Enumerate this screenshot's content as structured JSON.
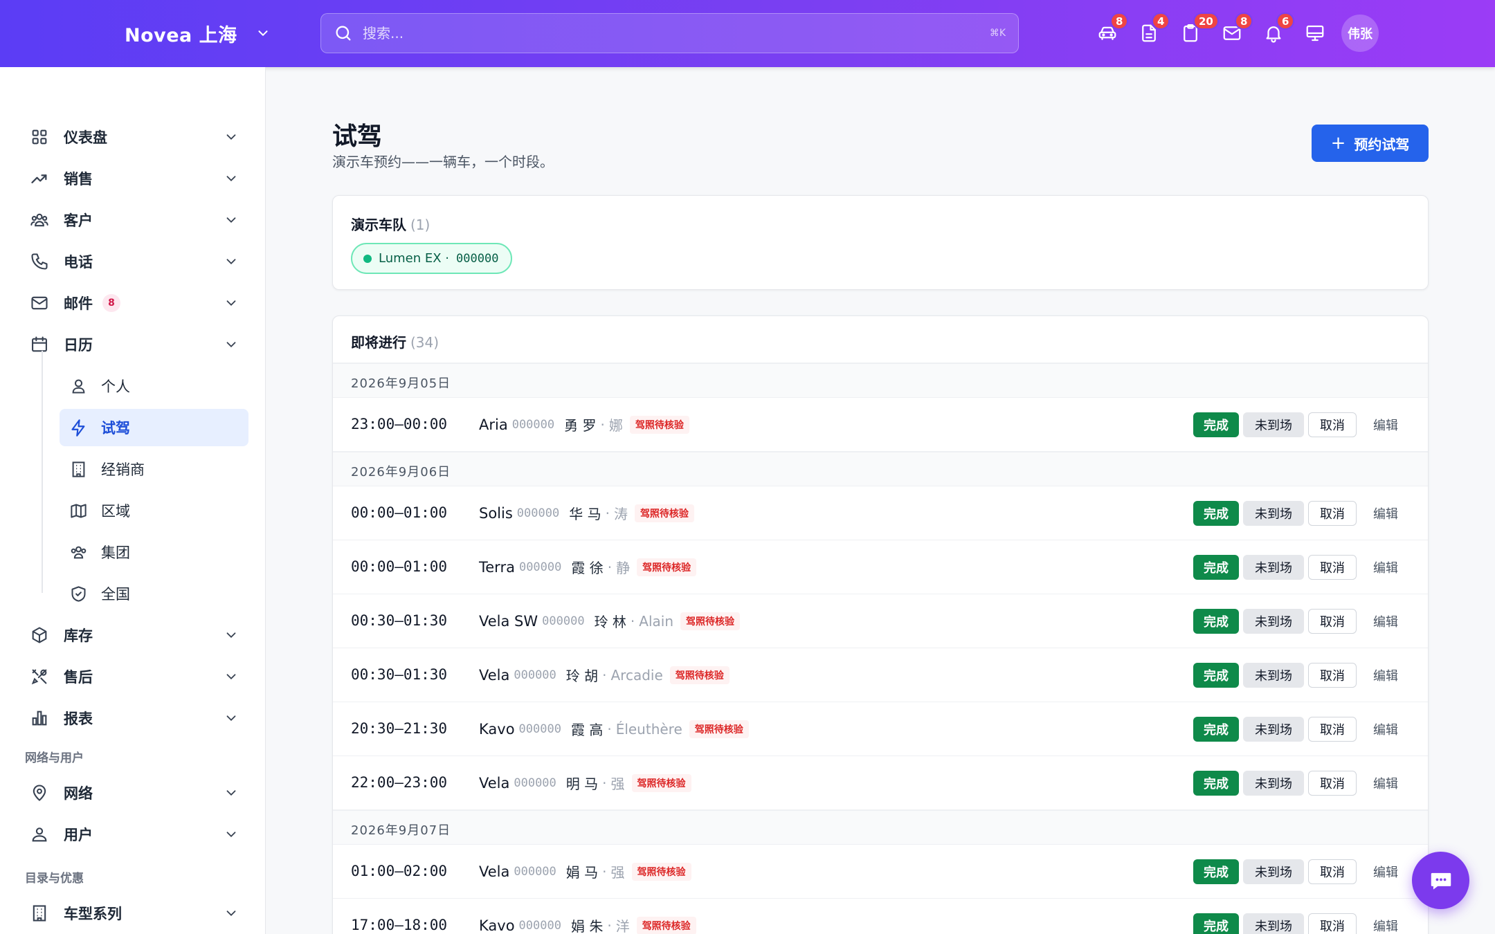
{
  "header": {
    "brand": "Novea 上海",
    "search_placeholder": "搜索...",
    "search_shortcut": "⌘K",
    "icons": [
      {
        "name": "car-icon",
        "badge": "8"
      },
      {
        "name": "document-icon",
        "badge": "4"
      },
      {
        "name": "clipboard-icon",
        "badge": "20"
      },
      {
        "name": "mail-icon",
        "badge": "8"
      },
      {
        "name": "bell-icon",
        "badge": "6"
      },
      {
        "name": "monitor-icon",
        "badge": ""
      }
    ],
    "avatar": "伟张"
  },
  "sidebar": {
    "items": [
      {
        "label": "仪表盘",
        "icon": "dashboard-icon"
      },
      {
        "label": "销售",
        "icon": "trending-up-icon"
      },
      {
        "label": "客户",
        "icon": "users-icon"
      },
      {
        "label": "电话",
        "icon": "phone-icon"
      },
      {
        "label": "邮件",
        "icon": "mail-icon",
        "badge": "8"
      },
      {
        "label": "日历",
        "icon": "calendar-icon"
      }
    ],
    "calendar_sub": [
      {
        "label": "个人",
        "icon": "user-icon"
      },
      {
        "label": "试驾",
        "icon": "bolt-icon",
        "active": true
      },
      {
        "label": "经销商",
        "icon": "building-icon"
      },
      {
        "label": "区域",
        "icon": "map-icon"
      },
      {
        "label": "集团",
        "icon": "group-icon"
      },
      {
        "label": "全国",
        "icon": "shield-icon"
      }
    ],
    "items_after": [
      {
        "label": "库存",
        "icon": "box-icon"
      },
      {
        "label": "售后",
        "icon": "tools-icon"
      },
      {
        "label": "报表",
        "icon": "bar-chart-icon"
      }
    ],
    "section_network": "网络与用户",
    "network_items": [
      {
        "label": "网络",
        "icon": "location-icon"
      },
      {
        "label": "用户",
        "icon": "user-admin-icon"
      }
    ],
    "section_catalog": "目录与优惠",
    "catalog_items": [
      {
        "label": "车型系列",
        "icon": "building-icon"
      }
    ]
  },
  "page": {
    "title": "试驾",
    "subtitle": "演示车预约——一辆车，一个时段。",
    "book_button": "预约试驾"
  },
  "fleet": {
    "title": "演示车队",
    "count": "(1)",
    "vehicle_name": "Lumen EX ·",
    "vehicle_vin": "000000"
  },
  "upcoming": {
    "title": "即将进行",
    "count": "(34)",
    "action_done": "完成",
    "action_noshow": "未到场",
    "action_cancel": "取消",
    "action_edit": "编辑",
    "groups": [
      {
        "date": "2026年9月05日",
        "rows": [
          {
            "time": "23:00–00:00",
            "model": "Aria",
            "vin": "000000",
            "customer": "勇 罗",
            "rep": "娜",
            "status": "驾照待核验"
          }
        ]
      },
      {
        "date": "2026年9月06日",
        "rows": [
          {
            "time": "00:00–01:00",
            "model": "Solis",
            "vin": "000000",
            "customer": "华 马",
            "rep": "涛",
            "status": "驾照待核验"
          },
          {
            "time": "00:00–01:00",
            "model": "Terra",
            "vin": "000000",
            "customer": "霞 徐",
            "rep": "静",
            "status": "驾照待核验"
          },
          {
            "time": "00:30–01:30",
            "model": "Vela SW",
            "vin": "000000",
            "customer": "玲 林",
            "rep": "Alain",
            "status": "驾照待核验"
          },
          {
            "time": "00:30–01:30",
            "model": "Vela",
            "vin": "000000",
            "customer": "玲 胡",
            "rep": "Arcadie",
            "status": "驾照待核验"
          },
          {
            "time": "20:30–21:30",
            "model": "Kavo",
            "vin": "000000",
            "customer": "霞 高",
            "rep": "Éleuthère",
            "status": "驾照待核验"
          },
          {
            "time": "22:00–23:00",
            "model": "Vela",
            "vin": "000000",
            "customer": "明 马",
            "rep": "强",
            "status": "驾照待核验"
          }
        ]
      },
      {
        "date": "2026年9月07日",
        "rows": [
          {
            "time": "01:00–02:00",
            "model": "Vela",
            "vin": "000000",
            "customer": "娟 马",
            "rep": "强",
            "status": "驾照待核验"
          },
          {
            "time": "17:00–18:00",
            "model": "Kavo",
            "vin": "000000",
            "customer": "娟 朱",
            "rep": "洋",
            "status": "驾照待核验"
          }
        ]
      }
    ]
  },
  "colors": {
    "header_gradient_start": "#5b3df5",
    "header_gradient_end": "#9b3cf6",
    "primary": "#2563eb",
    "done": "#0f8a4a",
    "warning": "#dc2626",
    "fab": "#7c3aed"
  }
}
